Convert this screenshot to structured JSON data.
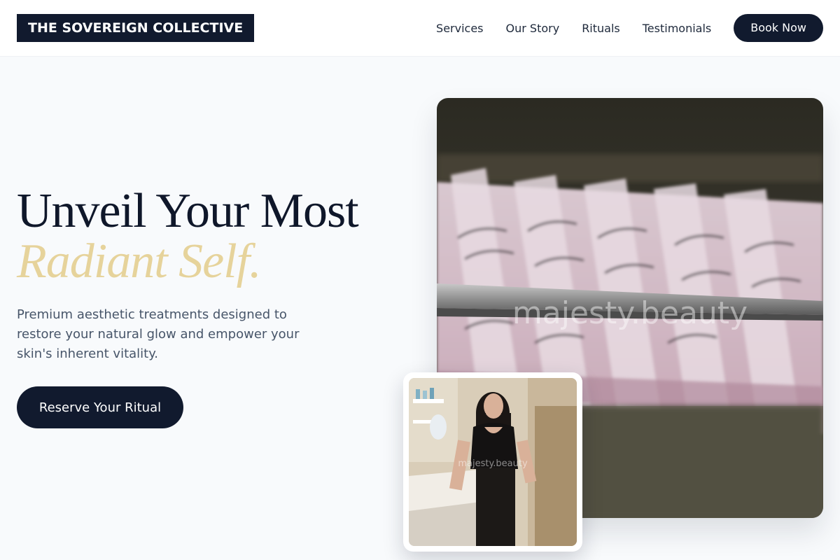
{
  "header": {
    "logo": "THE SOVEREIGN COLLECTIVE",
    "nav": [
      {
        "label": "Services"
      },
      {
        "label": "Our Story"
      },
      {
        "label": "Rituals"
      },
      {
        "label": "Testimonials"
      }
    ],
    "book_label": "Book Now"
  },
  "hero": {
    "title_line1": "Unveil Your Most",
    "title_line2": "Radiant Self.",
    "subtitle": "Premium aesthetic treatments designed to restore your natural glow and empower your skin's inherent vitality.",
    "cta_label": "Reserve Your Ritual"
  },
  "images": {
    "main_watermark": "majesty.beauty",
    "inset_watermark": "majesty.beauty"
  },
  "colors": {
    "navy": "#111a2e",
    "gold": "#e6d39b",
    "background": "#f8fafc"
  }
}
